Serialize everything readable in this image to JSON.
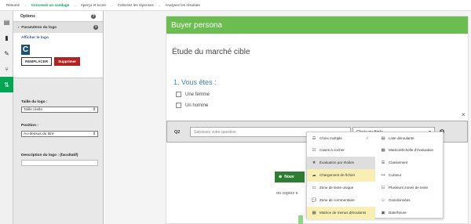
{
  "nav": {
    "steps": [
      "Résumé",
      "Concevez un sondage",
      "Aperçu et score",
      "Collectez les réponses",
      "Analysez les résultats"
    ],
    "active_index": 1,
    "arrow": "→"
  },
  "rail": {
    "icons": [
      "layers-icon",
      "bar-chart-icon",
      "paintbrush-icon",
      "logic-branch-icon",
      "sort-icon"
    ],
    "active_index": 4
  },
  "panel": {
    "header": "Options",
    "help_glyph": "?",
    "back_glyph": "‹",
    "sub_title": "Paramètres du logo",
    "show_logo_link": "Afficher le logo",
    "logo_letter": "C",
    "replace_button": "REMPLACER",
    "delete_button": "Supprimer",
    "logo_size_label": "Taille du logo :",
    "logo_size_value": "Taille réelle",
    "position_label": "Position :",
    "position_value": "Au-dessus du titre",
    "description_label": "Description du logo : (facultatif)",
    "description_value": ""
  },
  "survey": {
    "header": "Buyer persona",
    "title": "Étude du marché cible",
    "q1_title": "1. Vous êtes :",
    "q1_options": [
      "Une femme",
      "Un homme"
    ],
    "q2_number": "Q2",
    "q2_placeholder": "Saisissez votre question",
    "q2_type": "Choix multiple",
    "close_glyph": "×",
    "new_button": "Nouv",
    "new_button_glyph": "⊕",
    "or_copy_text": "ou copiez e"
  },
  "dropdown": {
    "left": [
      {
        "label": "Choix multiple",
        "icon": "list-icon",
        "glyph": "☰",
        "highlight": "none",
        "checked": false
      },
      {
        "label": "Cases à cocher",
        "icon": "checkbox-icon",
        "glyph": "☑",
        "highlight": "none",
        "checked": false
      },
      {
        "label": "Évaluation par étoiles",
        "icon": "star-icon",
        "glyph": "★",
        "highlight": "gray",
        "checked": false
      },
      {
        "label": "Chargement de fichier",
        "icon": "cloud-upload-icon",
        "glyph": "☁",
        "highlight": "yellow",
        "checked": false
      },
      {
        "label": "Zone de texte unique",
        "icon": "text-line-icon",
        "glyph": "▭",
        "highlight": "none",
        "checked": false
      },
      {
        "label": "Zone de commentaire",
        "icon": "comment-icon",
        "glyph": "💬",
        "highlight": "none",
        "checked": false
      },
      {
        "label": "Matrice de menus déroulants",
        "icon": "grid-icon",
        "glyph": "▦",
        "highlight": "yellow",
        "checked": false
      }
    ],
    "right": [
      {
        "label": "Liste déroulante",
        "icon": "dropdown-list-icon",
        "glyph": "▤",
        "highlight": "none",
        "checked": true
      },
      {
        "label": "Matrice/Échelle d'évaluation",
        "icon": "matrix-icon",
        "glyph": "▦",
        "highlight": "none",
        "checked": false
      },
      {
        "label": "Classement",
        "icon": "ranking-icon",
        "glyph": "☰",
        "highlight": "none",
        "checked": false
      },
      {
        "label": "Curseur",
        "icon": "slider-icon",
        "glyph": "⊶",
        "highlight": "none",
        "checked": false
      },
      {
        "label": "Plusieurs zones de texte",
        "icon": "multi-text-icon",
        "glyph": "☷",
        "highlight": "none",
        "checked": false
      },
      {
        "label": "Coordonnées",
        "icon": "contact-icon",
        "glyph": "☺",
        "highlight": "none",
        "checked": false
      },
      {
        "label": "Date/heure",
        "icon": "calendar-icon",
        "glyph": "▣",
        "highlight": "none",
        "checked": false
      }
    ],
    "check_glyph": "✓"
  },
  "colors": {
    "brand_green": "#00a651",
    "header_green": "#6bbd4f",
    "delete_red": "#b22222",
    "question_blue": "#3a84c4",
    "highlight_yellow": "#f9efb5"
  }
}
